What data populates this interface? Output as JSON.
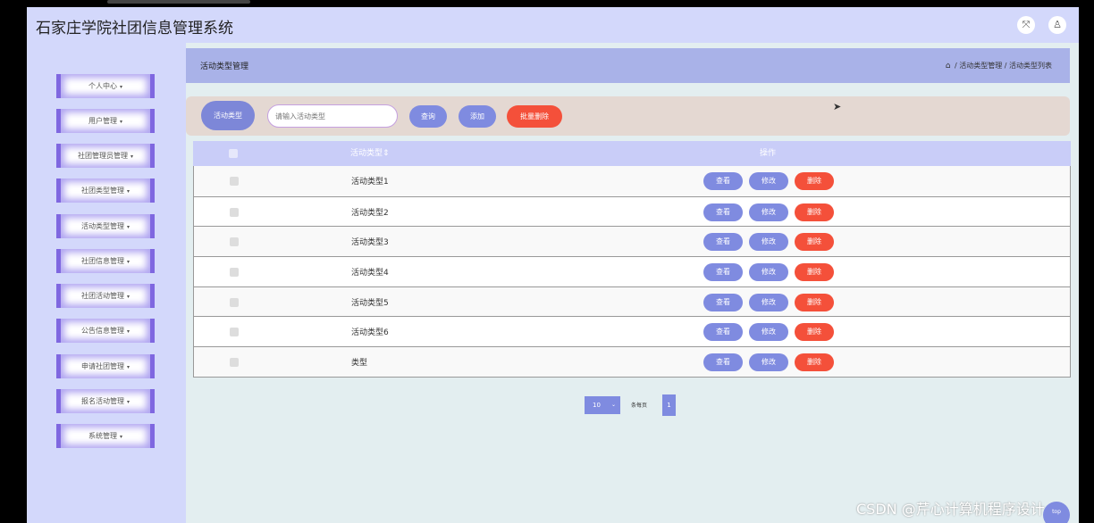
{
  "app": {
    "title": "石家庄学院社团信息管理系统",
    "expand_icon": "⤧",
    "user_icon": "♙"
  },
  "sidebar": {
    "items": [
      {
        "label": "个人中心"
      },
      {
        "label": "用户管理"
      },
      {
        "label": "社团管理员管理"
      },
      {
        "label": "社团类型管理"
      },
      {
        "label": "活动类型管理"
      },
      {
        "label": "社团信息管理"
      },
      {
        "label": "社团活动管理"
      },
      {
        "label": "公告信息管理"
      },
      {
        "label": "申请社团管理"
      },
      {
        "label": "报名活动管理"
      },
      {
        "label": "系统管理"
      }
    ],
    "caret": "▾"
  },
  "header": {
    "title": "活动类型管理",
    "home_icon": "⌂",
    "breadcrumb": "/ 活动类型管理 / 活动类型列表"
  },
  "search": {
    "label": "活动类型",
    "placeholder": "请输入活动类型",
    "query_label": "查询",
    "add_label": "添加",
    "batch_delete_label": "批量删除"
  },
  "table": {
    "columns": [
      "活动类型⇕",
      "操作"
    ],
    "rows": [
      {
        "name": "活动类型1"
      },
      {
        "name": "活动类型2"
      },
      {
        "name": "活动类型3"
      },
      {
        "name": "活动类型4"
      },
      {
        "name": "活动类型5"
      },
      {
        "name": "活动类型6"
      },
      {
        "name": "类型"
      }
    ],
    "actions": {
      "view": "查看",
      "edit": "修改",
      "delete": "删除"
    }
  },
  "pagination": {
    "page_size": "10",
    "dropdown_icon": "⌄",
    "page_size_label": "条每页",
    "current_page": "1"
  },
  "watermark": "CSDN @芹心计算机程序设计",
  "top_button": "top",
  "cursor_icon": "➤",
  "colors": {
    "accent": "#7f8be0",
    "danger": "#f4503a",
    "sidebar_bg": "#d3d8fb",
    "header_bar": "#a9b2e8"
  }
}
